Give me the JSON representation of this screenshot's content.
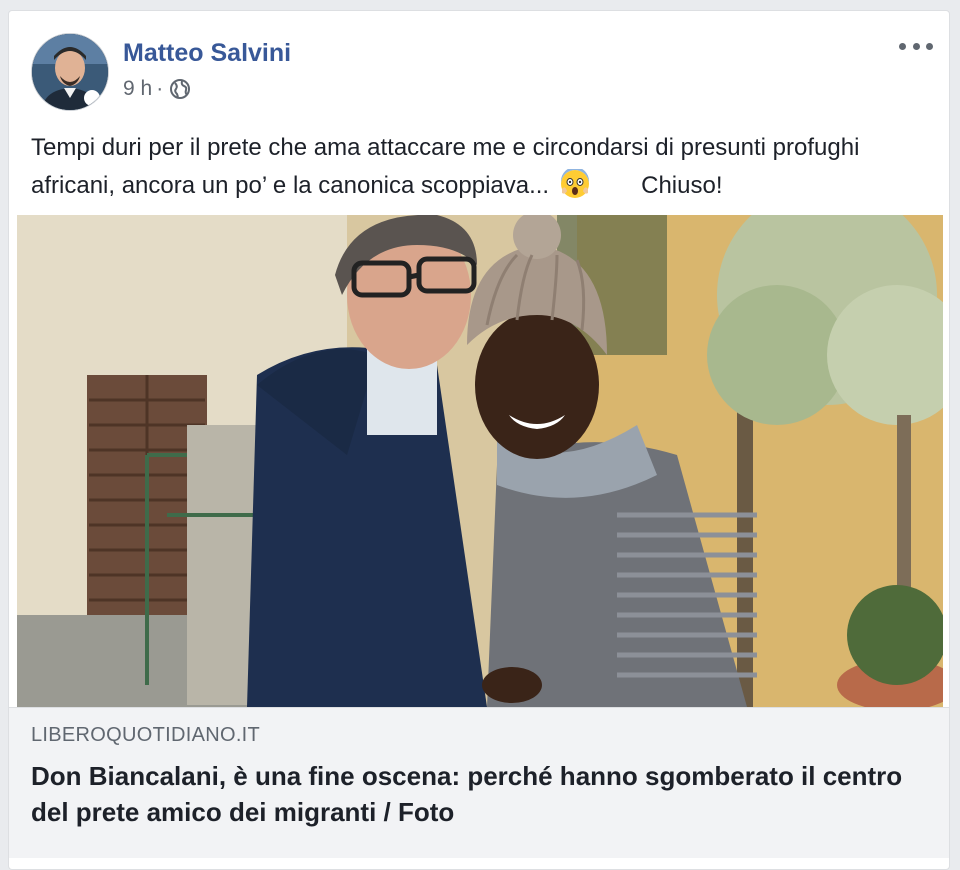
{
  "post": {
    "author": "Matteo Salvini",
    "time": "9 h",
    "separator": "·",
    "privacy_icon": "globe-icon",
    "text_part1": "Tempi duri per il prete che ama attaccare me e circondarsi di presunti profughi africani, ancora un po’ e la canonica scoppiava...",
    "emoji": "face-screaming-in-fear-icon",
    "text_part2": "Chiuso!"
  },
  "link": {
    "domain": "LIBEROQUOTIDIANO.IT",
    "title": "Don Biancalani, è una fine oscena: perché hanno sgomberato il centro del prete amico dei migranti / Foto"
  },
  "colors": {
    "author": "#385898",
    "text": "#1d2129",
    "meta": "#616770",
    "link_bg": "#f2f3f5"
  }
}
